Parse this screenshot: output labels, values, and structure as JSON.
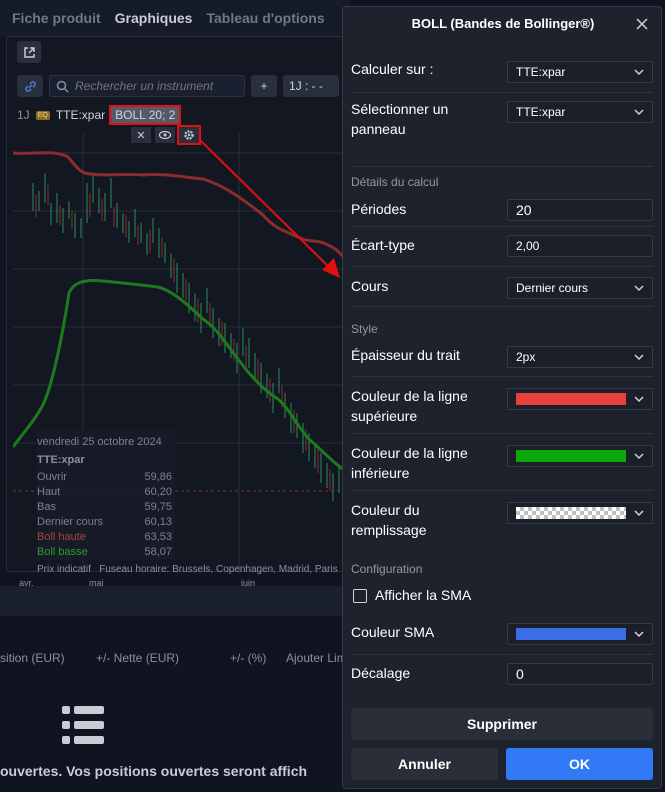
{
  "tabs": [
    "Fiche produit",
    "Graphiques",
    "Tableau d'options"
  ],
  "toolbar": {
    "search_placeholder": "Rechercher un instrument",
    "add_label": "+",
    "timeframe": "1J : - -"
  },
  "legend": {
    "timeframe": "1J",
    "badge": "EQ",
    "symbol": "TTE:xpar",
    "indicator": "BOLL 20; 2"
  },
  "tooltip": {
    "date": "vendredi 25 octobre 2024",
    "symbol": "TTE:xpar",
    "rows": [
      {
        "label": "Ouvrir",
        "value": "59,86"
      },
      {
        "label": "Haut",
        "value": "60,20"
      },
      {
        "label": "Bas",
        "value": "59,75"
      },
      {
        "label": "Dernier cours",
        "value": "60,13"
      },
      {
        "label": "Boll haute",
        "value": "63,53"
      },
      {
        "label": "Boll basse",
        "value": "58,07"
      }
    ]
  },
  "footnote": {
    "prefix": "Prix indicatif",
    "tz": "Fuseau horaire: Brussels, Copenhagen, Madrid, Paris"
  },
  "xaxis": [
    "avr.",
    "mai",
    "juin"
  ],
  "positions": {
    "headers": [
      "sition (EUR)",
      "+/- Nette (EUR)",
      "+/- (%)",
      "Ajouter Lim"
    ],
    "empty_message": "ouvertes. Vos positions ouvertes seront affich"
  },
  "dialog": {
    "title": "BOLL (Bandes de Bollinger®)",
    "calc_on_label": "Calculer sur :",
    "calc_on_value": "TTE:xpar",
    "panel_label": "Sélectionner un panneau",
    "panel_value": "TTE:xpar",
    "section_calc": "Détails du calcul",
    "periods_label": "Périodes",
    "periods_value": "20",
    "stddev_label": "Écart-type",
    "stddev_value": "2,00",
    "price_label": "Cours",
    "price_value": "Dernier cours",
    "section_style": "Style",
    "width_label": "Épaisseur du trait",
    "width_value": "2px",
    "upper_label": "Couleur de la ligne supérieure",
    "upper_color": "#e8403a",
    "lower_label": "Couleur de la ligne inférieure",
    "lower_color": "#0aa80a",
    "fill_label": "Couleur du remplissage",
    "section_config": "Configuration",
    "sma_toggle_label": "Afficher la SMA",
    "sma_color_label": "Couleur SMA",
    "sma_color": "#3b6ee6",
    "offset_label": "Décalage",
    "offset_value": "0",
    "delete_label": "Supprimer",
    "cancel_label": "Annuler",
    "ok_label": "OK"
  }
}
